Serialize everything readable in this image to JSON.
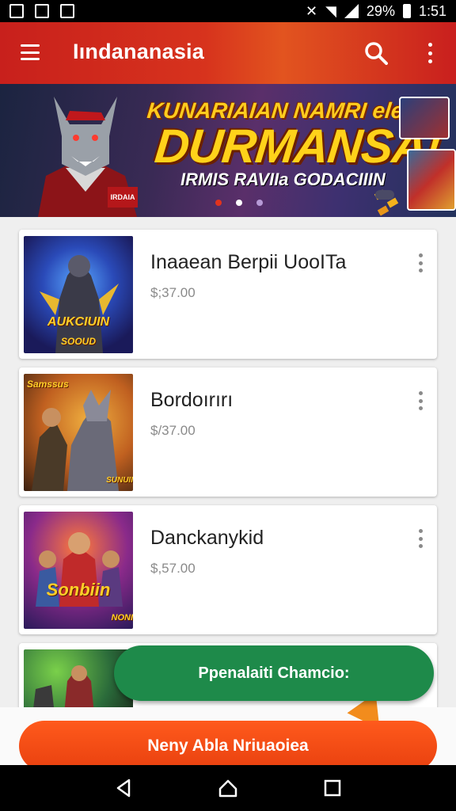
{
  "status_bar": {
    "battery": "29%",
    "time": "1:51"
  },
  "app_bar": {
    "title": "Iındananasia",
    "menu_icon": "hamburger-menu-icon",
    "search_icon": "search-icon",
    "more_icon": "more-vertical-icon"
  },
  "banner": {
    "headline_small": "KUNARIAIAN NAMRI eleiaii..",
    "headline_large": "DURMANSA!",
    "subtitle": "IRMIS RAVIIa GODACIIIN",
    "badge": "IRDAIA",
    "active_dot": 1,
    "dot_colors": [
      "#e2331d",
      "#ffffff",
      "#b69ad6"
    ]
  },
  "items": [
    {
      "title": "Inaaean Berpii UooITa",
      "price": "$;37.00",
      "thumb_label": "AUKCIUIN",
      "thumb_sublabel": "SOOUD"
    },
    {
      "title": "Bordoırırı",
      "price": "$/37.00",
      "thumb_label": "Samssus",
      "thumb_sublabel": "SUNUII"
    },
    {
      "title": "Danckanykid",
      "price": "$,57.00",
      "thumb_label": "Sonbiin",
      "thumb_sublabel": "NONI"
    },
    {
      "title": "",
      "price": "",
      "thumb_label": "",
      "thumb_sublabel": ""
    }
  ],
  "toast": {
    "text": "Ppenalaiti Chamcio:"
  },
  "cta": {
    "label": "Neny Abla Nriuaoiea"
  },
  "nav": {
    "back_icon": "back-triangle-icon",
    "home_icon": "home-icon",
    "recents_icon": "recents-square-icon"
  },
  "colors": {
    "app_bar": "#d7331d",
    "toast": "#1e8a4a",
    "cta": "#f04a15",
    "banner_text": "#ffd21a"
  }
}
